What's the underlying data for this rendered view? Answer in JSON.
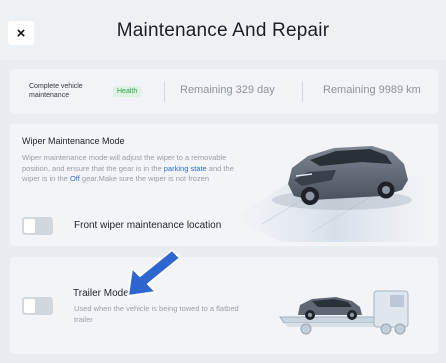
{
  "header": {
    "close_label": "×",
    "title": "Maintenance And Repair"
  },
  "status": {
    "label_line1": "Complete vehicle",
    "label_line2": "maintenance",
    "badge": "Health",
    "remaining_days": "Remaining 329 day",
    "remaining_km": "Remaining 9989 km"
  },
  "wiper": {
    "title": "Wiper Maintenance Mode",
    "desc_part1": "Wiper maintenance mode will adjust the wiper to a removable position, and ensure that the gear is in the ",
    "desc_link1": "parking state",
    "desc_part2": " and the wiper is in the ",
    "desc_link2": "Off",
    "desc_part3": " gear.Make sure the wiper is not frozen",
    "location_label": "Front wiper maintenance location",
    "toggle_on": false
  },
  "trailer": {
    "title": "Trailer Mode",
    "desc": "Used when the vehicle is being towed to a flatbed trailer",
    "toggle_on": false
  },
  "colors": {
    "accent_blue": "#2f6fd6",
    "health_green": "#2fa352"
  },
  "icons": {
    "close": "close-icon",
    "car": "suv-car-icon",
    "truck": "flatbed-truck-icon",
    "pointer": "pointer-arrow-icon"
  }
}
